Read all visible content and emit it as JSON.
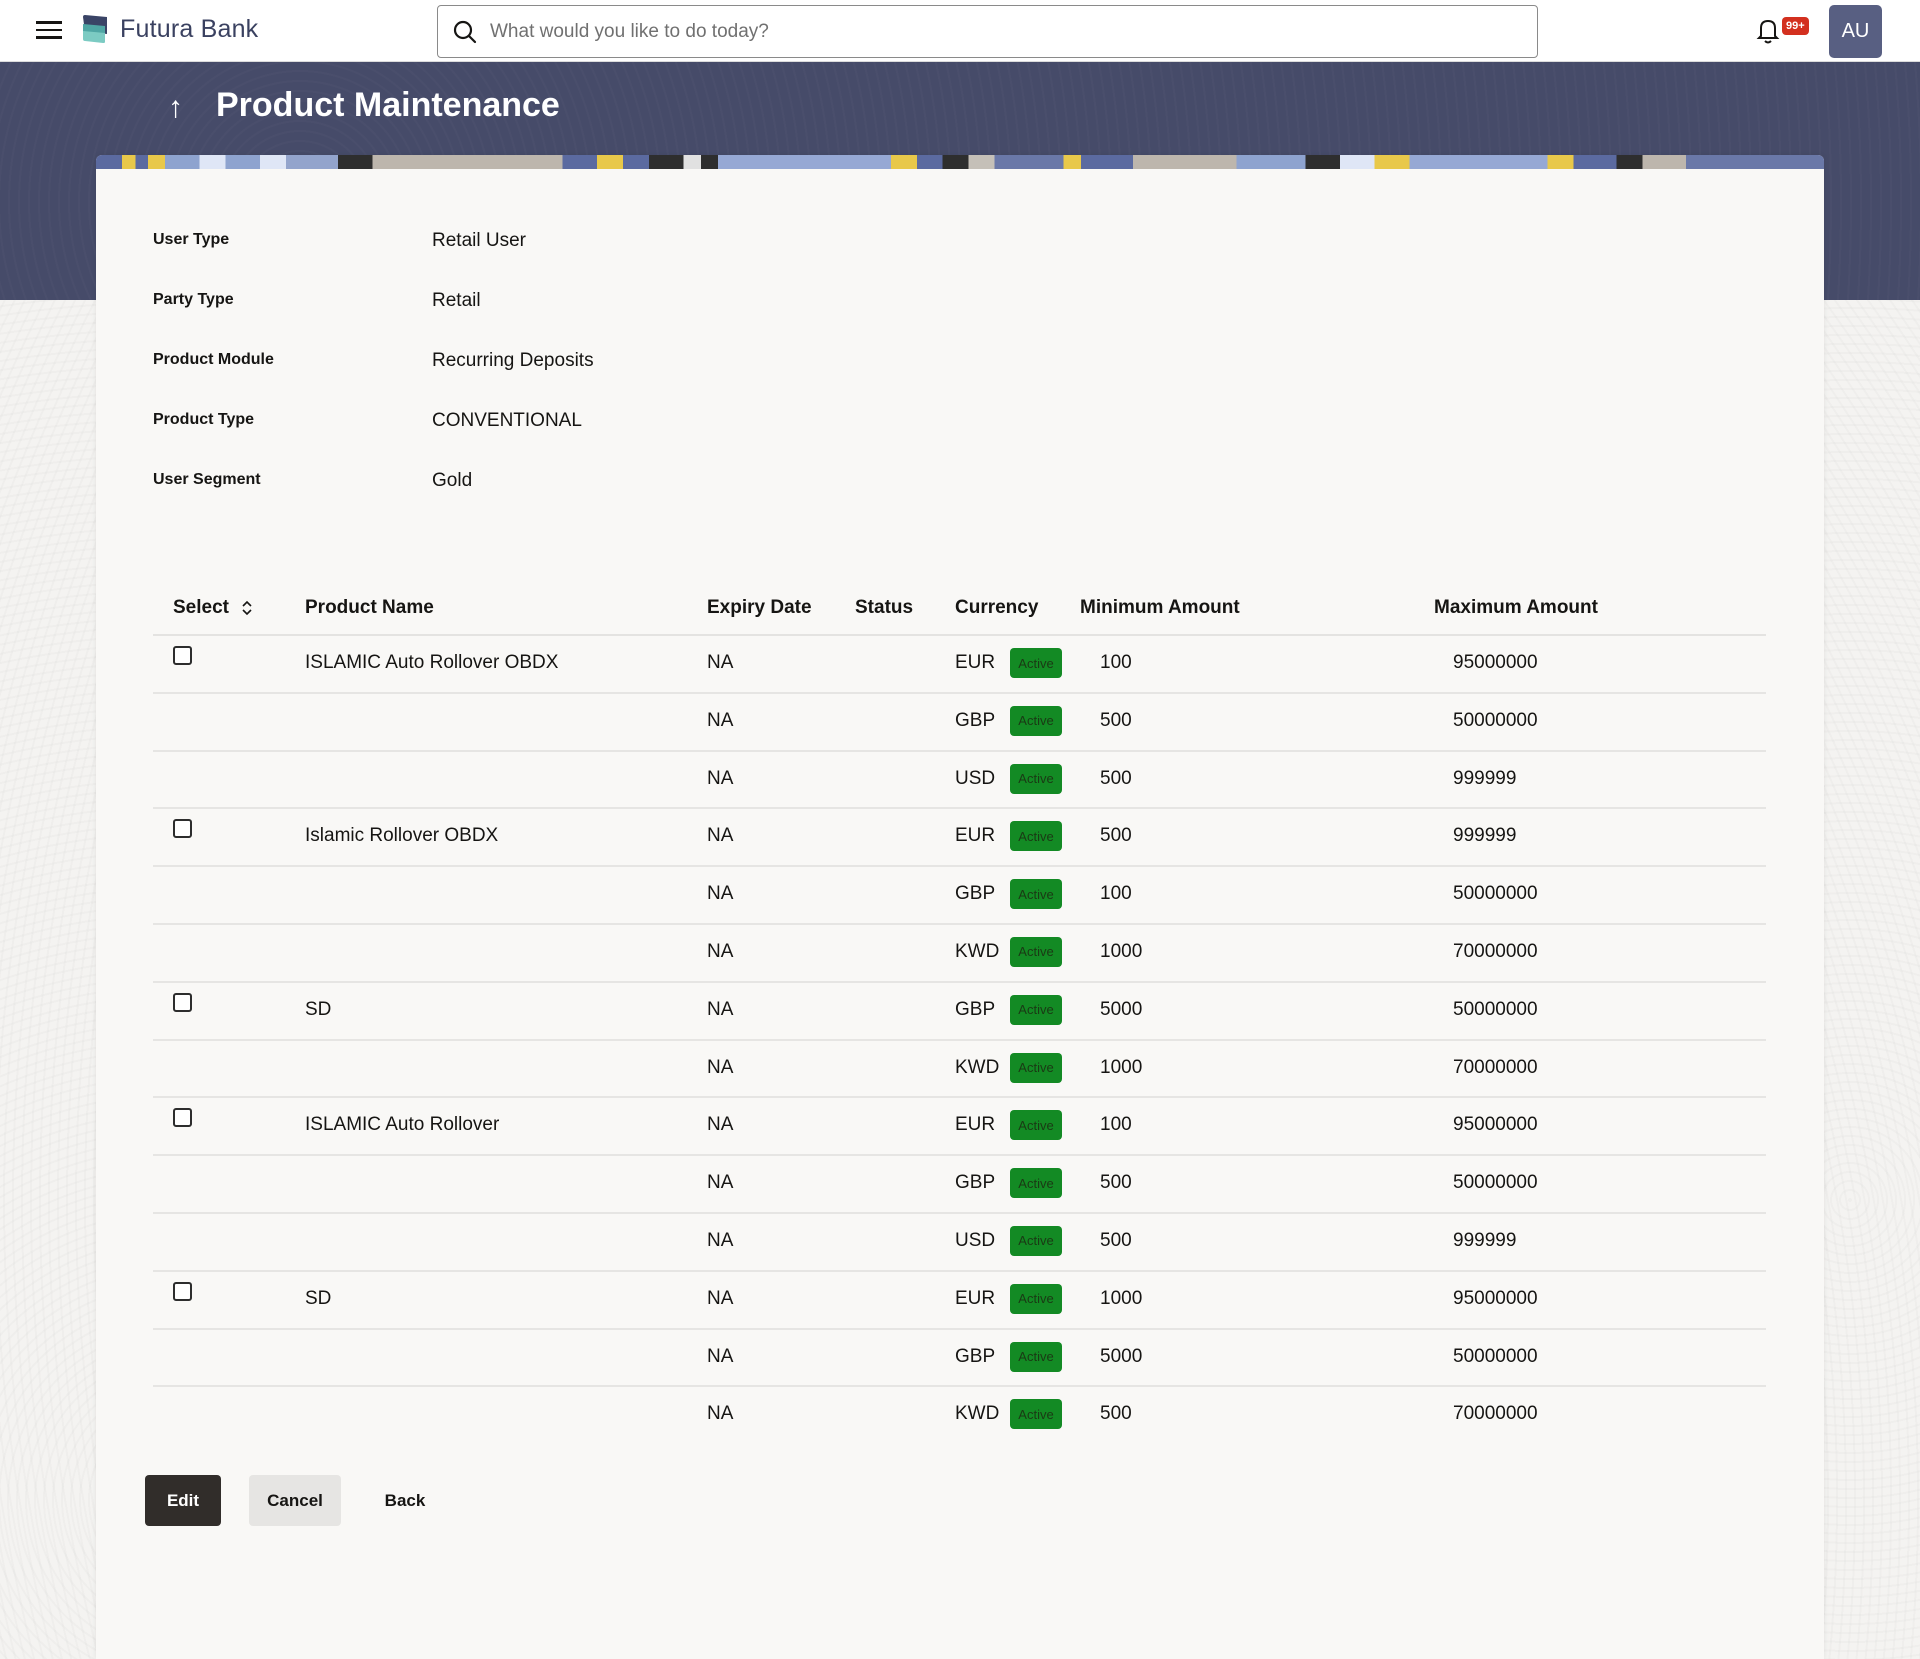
{
  "header": {
    "brand": "Futura Bank",
    "search_placeholder": "What would you like to do today?",
    "notification_count": "99+",
    "avatar_initials": "AU"
  },
  "page": {
    "title": "Product Maintenance",
    "back_arrow": "↑"
  },
  "info": [
    {
      "label": "User Type",
      "value": "Retail User"
    },
    {
      "label": "Party Type",
      "value": "Retail"
    },
    {
      "label": "Product Module",
      "value": "Recurring Deposits"
    },
    {
      "label": "Product Type",
      "value": "CONVENTIONAL"
    },
    {
      "label": "User Segment",
      "value": "Gold"
    }
  ],
  "table": {
    "columns": {
      "select": "Select",
      "product_name": "Product Name",
      "expiry_date": "Expiry Date",
      "status": "Status",
      "currency": "Currency",
      "minimum_amount": "Minimum Amount",
      "maximum_amount": "Maximum Amount"
    },
    "rows": [
      {
        "checkbox": true,
        "product_name": "ISLAMIC Auto Rollover OBDX",
        "expiry_date": "NA",
        "status": "Active",
        "currency": "EUR",
        "min": "100",
        "max": "95000000"
      },
      {
        "checkbox": false,
        "product_name": "",
        "expiry_date": "NA",
        "status": "Active",
        "currency": "GBP",
        "min": "500",
        "max": "50000000"
      },
      {
        "checkbox": false,
        "product_name": "",
        "expiry_date": "NA",
        "status": "Active",
        "currency": "USD",
        "min": "500",
        "max": "999999"
      },
      {
        "checkbox": true,
        "product_name": "Islamic Rollover OBDX",
        "expiry_date": "NA",
        "status": "Active",
        "currency": "EUR",
        "min": "500",
        "max": "999999"
      },
      {
        "checkbox": false,
        "product_name": "",
        "expiry_date": "NA",
        "status": "Active",
        "currency": "GBP",
        "min": "100",
        "max": "50000000"
      },
      {
        "checkbox": false,
        "product_name": "",
        "expiry_date": "NA",
        "status": "Active",
        "currency": "KWD",
        "min": "1000",
        "max": "70000000"
      },
      {
        "checkbox": true,
        "product_name": "SD",
        "expiry_date": "NA",
        "status": "Active",
        "currency": "GBP",
        "min": "5000",
        "max": "50000000"
      },
      {
        "checkbox": false,
        "product_name": "",
        "expiry_date": "NA",
        "status": "Active",
        "currency": "KWD",
        "min": "1000",
        "max": "70000000"
      },
      {
        "checkbox": true,
        "product_name": "ISLAMIC Auto Rollover",
        "expiry_date": "NA",
        "status": "Active",
        "currency": "EUR",
        "min": "100",
        "max": "95000000"
      },
      {
        "checkbox": false,
        "product_name": "",
        "expiry_date": "NA",
        "status": "Active",
        "currency": "GBP",
        "min": "500",
        "max": "50000000"
      },
      {
        "checkbox": false,
        "product_name": "",
        "expiry_date": "NA",
        "status": "Active",
        "currency": "USD",
        "min": "500",
        "max": "999999"
      },
      {
        "checkbox": true,
        "product_name": "SD",
        "expiry_date": "NA",
        "status": "Active",
        "currency": "EUR",
        "min": "1000",
        "max": "95000000"
      },
      {
        "checkbox": false,
        "product_name": "",
        "expiry_date": "NA",
        "status": "Active",
        "currency": "GBP",
        "min": "5000",
        "max": "50000000"
      },
      {
        "checkbox": false,
        "product_name": "",
        "expiry_date": "NA",
        "status": "Active",
        "currency": "KWD",
        "min": "500",
        "max": "70000000"
      }
    ]
  },
  "buttons": {
    "edit": "Edit",
    "cancel": "Cancel",
    "back": "Back"
  },
  "colors": {
    "band": "#464b69",
    "status_active": "#138a24",
    "primary_button": "#312d2a",
    "avatar": "#585f82",
    "notification_badge": "#d3301f"
  }
}
